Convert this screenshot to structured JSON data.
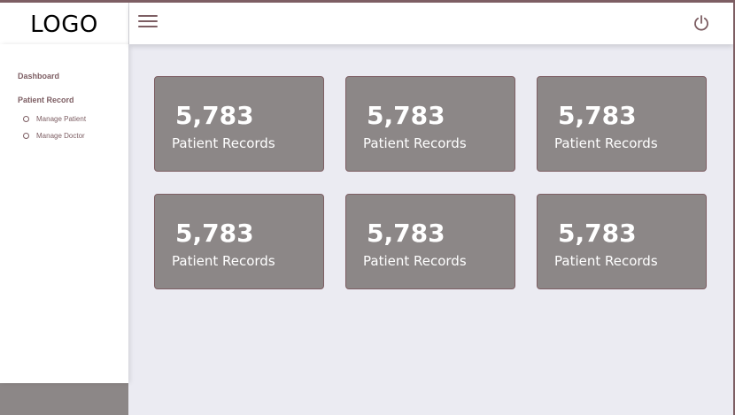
{
  "logo": {
    "text": "LOGO"
  },
  "topbar": {
    "menu_icon": "hamburger-icon",
    "power_icon": "power-icon"
  },
  "sidebar": {
    "sections": [
      {
        "label": "Dashboard"
      },
      {
        "label": "Patient Record",
        "items": [
          {
            "label": "Manage Patient"
          },
          {
            "label": "Manage Doctor"
          }
        ]
      }
    ]
  },
  "cards": [
    {
      "value": "5,783",
      "label": "Patient Records"
    },
    {
      "value": "5,783",
      "label": "Patient Records"
    },
    {
      "value": "5,783",
      "label": "Patient Records"
    },
    {
      "value": "5,783",
      "label": "Patient Records"
    },
    {
      "value": "5,783",
      "label": "Patient Records"
    },
    {
      "value": "5,783",
      "label": "Patient Records"
    }
  ],
  "colors": {
    "accent": "#7d5e63",
    "card_bg": "#8c8787",
    "page_bg": "#ebebf2"
  }
}
